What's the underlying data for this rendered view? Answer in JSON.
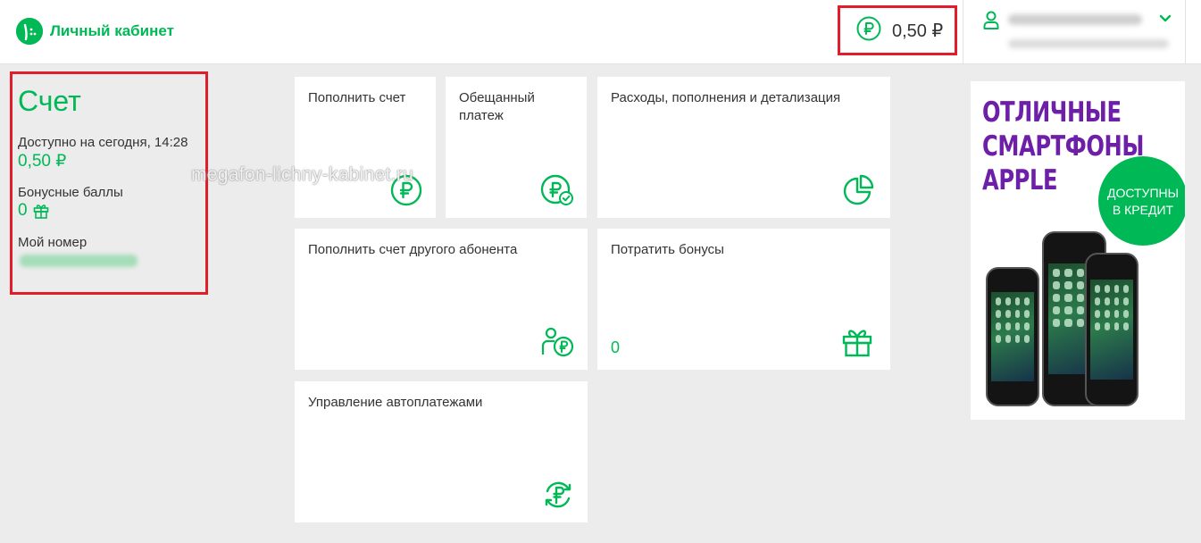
{
  "header": {
    "logo_text": "Личный кабинет",
    "balance": "0,50 ₽"
  },
  "account": {
    "title": "Счет",
    "available_label": "Доступно на сегодня, 14:28",
    "available_value": "0,50 ₽",
    "bonus_label": "Бонусные баллы",
    "bonus_value": "0",
    "number_label": "Мой номер"
  },
  "watermark": "megafon-lichny-kabinet.ru",
  "tiles": [
    {
      "title": "Пополнить счет",
      "icon": "ruble-circle-icon"
    },
    {
      "title": "Обещанный платеж",
      "icon": "ruble-check-icon"
    },
    {
      "title": "Расходы, пополнения и детализация",
      "icon": "pie-chart-icon"
    },
    {
      "title": "Пополнить счет другого абонента",
      "icon": "user-ruble-icon"
    },
    {
      "title": "Потратить бонусы",
      "icon": "gift-icon",
      "count": "0"
    },
    {
      "title": "Управление автоплатежами",
      "icon": "ruble-cycle-icon"
    }
  ],
  "ad": {
    "line1": "ОТЛИЧНЫЕ",
    "line2": "СМАРТФОНЫ",
    "line3": "APPLE",
    "badge_line1": "ДОСТУПНЫ",
    "badge_line2": "В КРЕДИТ"
  },
  "colors": {
    "brand_green": "#00b956",
    "highlight_red": "#e01d2b",
    "ad_purple": "#6d1fa8",
    "background": "#ececec"
  }
}
